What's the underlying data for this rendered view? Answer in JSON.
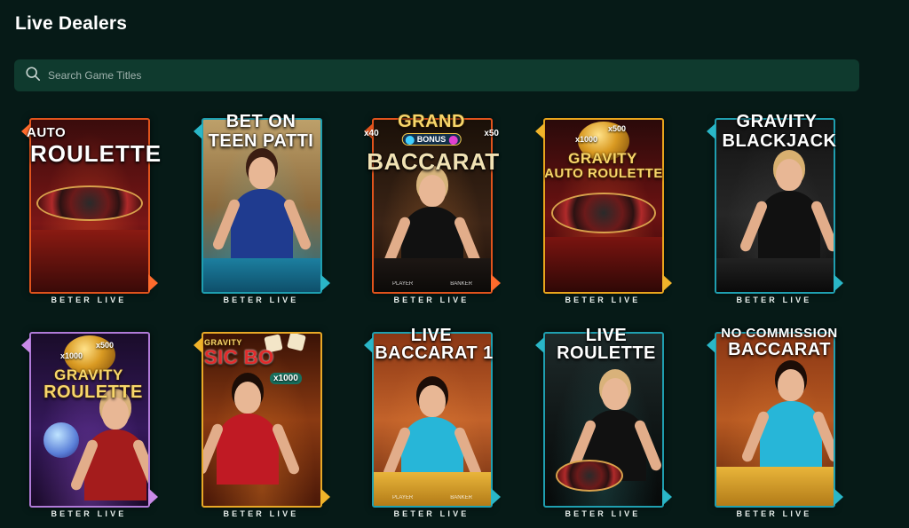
{
  "page": {
    "title": "Live Dealers"
  },
  "search": {
    "placeholder": "Search Game Titles"
  },
  "games": [
    {
      "lines": [
        "AUTO",
        "ROULETTE"
      ],
      "provider": "BETER LIVE"
    },
    {
      "lines": [
        "BET ON",
        "TEEN PATTI"
      ],
      "provider": "BETER LIVE"
    },
    {
      "lines": [
        "GRAND",
        "BACCARAT"
      ],
      "pill": "BONUS",
      "badges": [
        "x40",
        "x50"
      ],
      "provider": "BETER LIVE"
    },
    {
      "lines": [
        "GRAVITY",
        "AUTO ROULETTE"
      ],
      "badges": [
        "x1000",
        "x500"
      ],
      "provider": "BETER LIVE"
    },
    {
      "lines": [
        "GRAVITY",
        "BLACKJACK"
      ],
      "provider": "BETER LIVE"
    },
    {
      "lines": [
        "GRAVITY",
        "ROULETTE"
      ],
      "badges": [
        "x1000",
        "x500"
      ],
      "provider": "BETER LIVE"
    },
    {
      "lines": [
        "GRAVITY",
        "SIC BO"
      ],
      "badges": [
        "x1000"
      ],
      "provider": "BETER LIVE"
    },
    {
      "lines": [
        "LIVE",
        "BACCARAT 1"
      ],
      "provider": "BETER LIVE"
    },
    {
      "lines": [
        "LIVE",
        "ROULETTE"
      ],
      "provider": "BETER LIVE"
    },
    {
      "lines": [
        "NO COMMISSION",
        "BACCARAT"
      ],
      "provider": "BETER LIVE"
    }
  ],
  "table_labels": {
    "player": "PLAYER",
    "banker": "BANKER"
  },
  "colors": {
    "background": "#061a17",
    "search_bg": "#0f3a2e"
  }
}
